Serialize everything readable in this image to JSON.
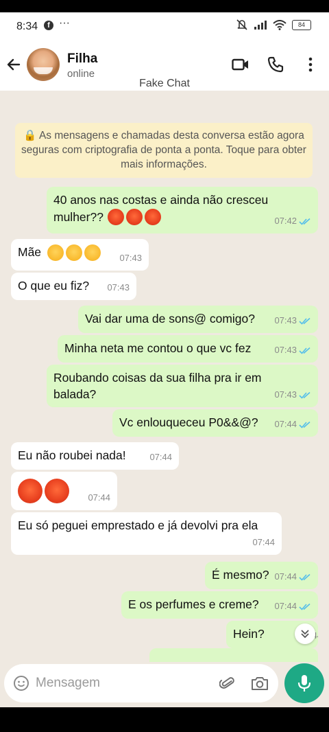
{
  "status_bar": {
    "time": "8:34",
    "fb": "f",
    "dots": "···",
    "battery": "84"
  },
  "header": {
    "name": "Filha",
    "status": "online"
  },
  "watermark": "Fake Chat",
  "encryption_notice": "🔒 As mensagens e chamadas desta conversa estão agora seguras com criptografia de ponta a ponta. Toque para obter mais informações.",
  "messages": [
    {
      "text": "40 anos nas costas e ainda não cresceu",
      "text2": "mulher??",
      "time": "07:42"
    },
    {
      "text": "Mãe",
      "time": "07:43"
    },
    {
      "text": "O que eu fiz?",
      "time": "07:43"
    },
    {
      "text": "Vai dar uma de sons@ comigo?",
      "time": "07:43"
    },
    {
      "text": "Minha neta me contou o que vc fez",
      "time": "07:43"
    },
    {
      "text": "Roubando coisas da sua filha pra ir em",
      "text2": "balada?",
      "time": "07:43"
    },
    {
      "text": "Vc enlouqueceu P0&&@?",
      "time": "07:44"
    },
    {
      "text": "Eu não roubei nada!",
      "time": "07:44"
    },
    {
      "text": "",
      "time": "07:44"
    },
    {
      "text": "Eu só peguei emprestado e já devolvi pra ela",
      "time": "07:44"
    },
    {
      "text": "É mesmo?",
      "time": "07:44"
    },
    {
      "text": "E os perfumes e creme?",
      "time": "07:44"
    },
    {
      "text": "Hein?",
      "time": "07:44"
    }
  ],
  "input": {
    "placeholder": "Mensagem"
  },
  "colors": {
    "outgoing": "#dcf8c6",
    "incoming": "#ffffff",
    "accent": "#1ea985",
    "read_ticks": "#53bdeb"
  }
}
